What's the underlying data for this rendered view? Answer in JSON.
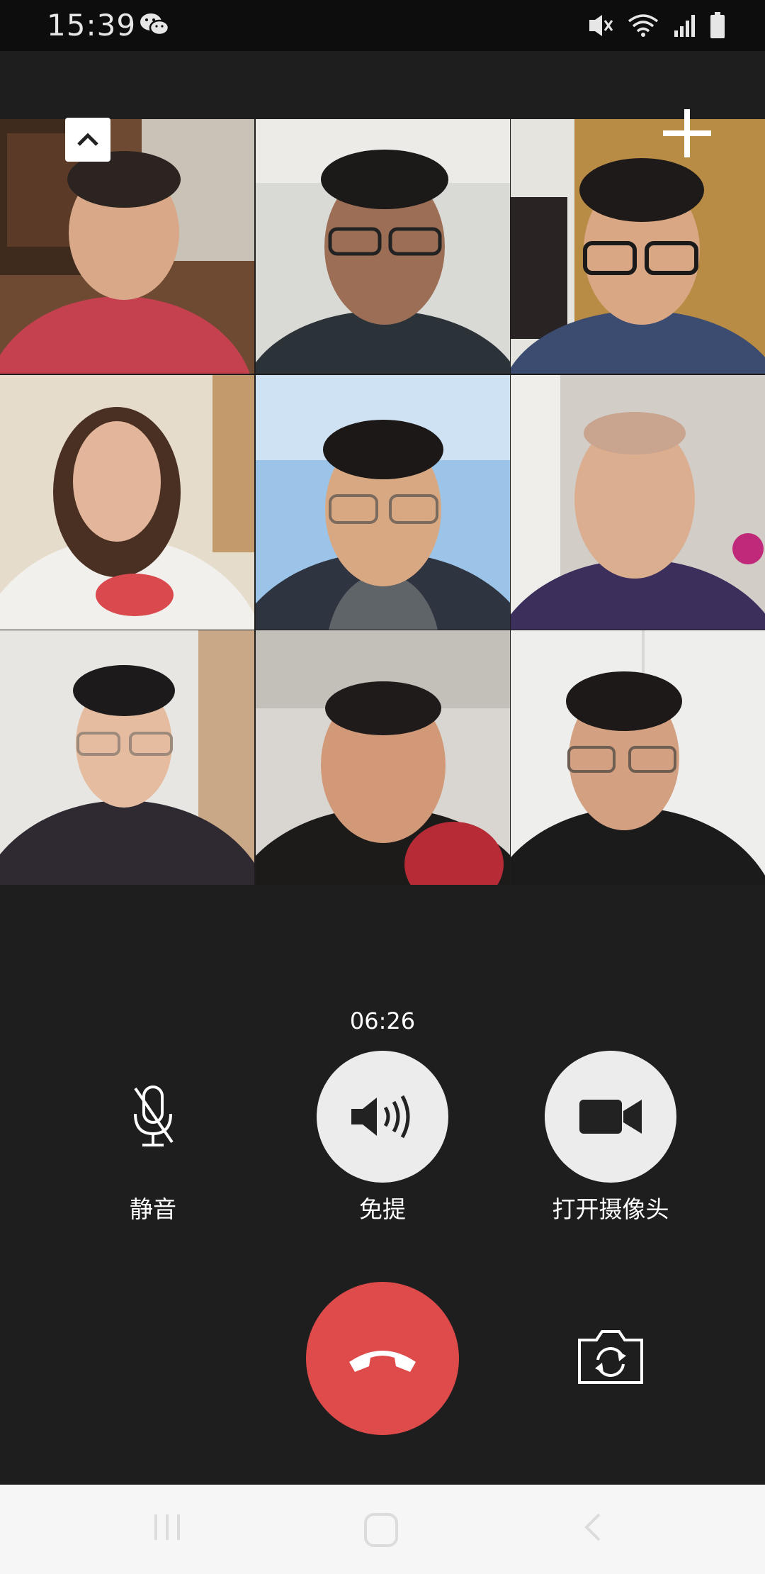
{
  "status_bar": {
    "time": "15:39",
    "icons": [
      "wechat-icon",
      "mute-vibrate-icon",
      "wifi-icon",
      "signal-icon",
      "battery-icon"
    ]
  },
  "call": {
    "participants_count": 9,
    "timer": "06:26",
    "controls": {
      "mute_label": "静音",
      "speaker_label": "免提",
      "camera_label": "打开摄像头"
    }
  },
  "colors": {
    "background": "#1f1e1f",
    "hangup": "#de4b4a",
    "control_fill": "#ececec"
  }
}
